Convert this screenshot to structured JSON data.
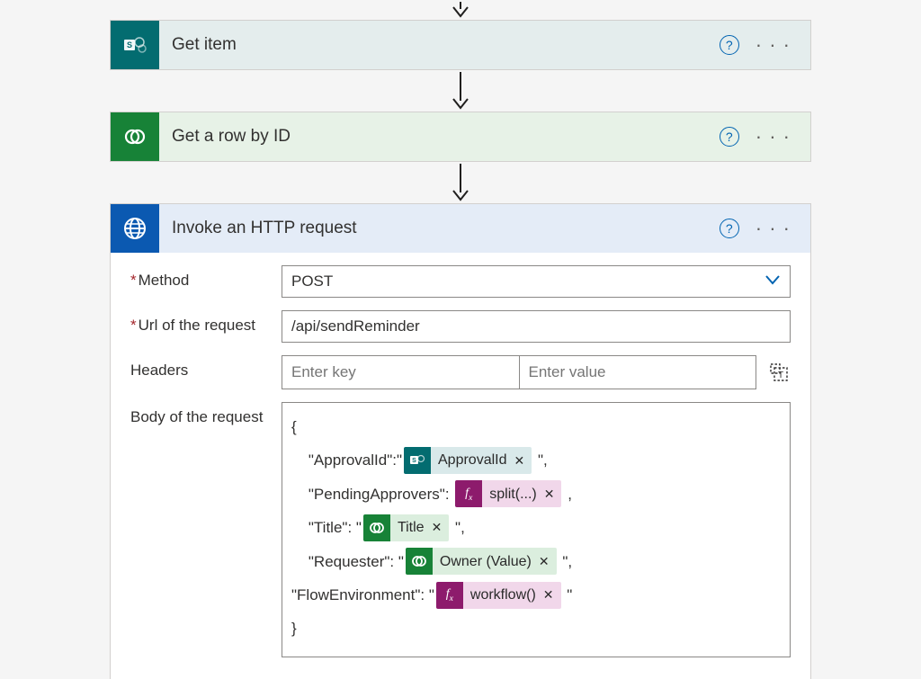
{
  "actions": {
    "sharepoint": {
      "title": "Get item"
    },
    "dataverse": {
      "title": "Get a row by ID"
    },
    "http": {
      "title": "Invoke an HTTP request"
    }
  },
  "httpForm": {
    "labels": {
      "method": "Method",
      "url": "Url of the request",
      "headers": "Headers",
      "body": "Body of the request"
    },
    "placeholders": {
      "headerKey": "Enter key",
      "headerValue": "Enter value"
    },
    "method": "POST",
    "url": "/api/sendReminder",
    "body": {
      "open": "{",
      "close": "}",
      "lines": [
        {
          "keyText": "\"ApprovalId\":\"",
          "token": {
            "type": "sp",
            "label": "ApprovalId"
          },
          "after": " \","
        },
        {
          "keyText": "\"PendingApprovers\": ",
          "token": {
            "type": "fx",
            "label": "split(...)"
          },
          "after": " ,"
        },
        {
          "keyText": "\"Title\": \"",
          "token": {
            "type": "dv",
            "label": "Title"
          },
          "after": " \","
        },
        {
          "keyText": "\"Requester\": \"",
          "token": {
            "type": "dv",
            "label": "Owner (Value)"
          },
          "after": " \","
        },
        {
          "keyText": "\"FlowEnvironment\": \"",
          "token": {
            "type": "fx",
            "label": "workflow()"
          },
          "after": " \"",
          "noIndent": true
        }
      ]
    }
  }
}
